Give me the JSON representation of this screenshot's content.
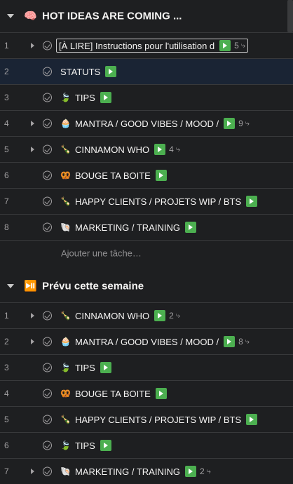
{
  "sections": [
    {
      "emoji": "🧠",
      "title": "HOT IDEAS ARE COMING ...",
      "add_task": "Ajouter une tâche…",
      "tasks": [
        {
          "num": "1",
          "emoji": "",
          "name": "[À LIRE] Instructions pour l'utilisation d",
          "expand": true,
          "subtasks": "5",
          "editing": true
        },
        {
          "num": "2",
          "emoji": "",
          "name": "STATUTS",
          "expand": false,
          "subtasks": "",
          "selected": true
        },
        {
          "num": "3",
          "emoji": "🍃",
          "name": "TIPS",
          "expand": false,
          "subtasks": ""
        },
        {
          "num": "4",
          "emoji": "🧁",
          "name": "MANTRA / GOOD VIBES / MOOD /",
          "expand": true,
          "subtasks": "9"
        },
        {
          "num": "5",
          "emoji": "🍾",
          "name": "CINNAMON WHO",
          "expand": true,
          "subtasks": "4"
        },
        {
          "num": "6",
          "emoji": "🥨",
          "name": "BOUGE TA BOITE",
          "expand": false,
          "subtasks": ""
        },
        {
          "num": "7",
          "emoji": "🍾",
          "name": "HAPPY CLIENTS / PROJETS WIP / BTS",
          "expand": false,
          "subtasks": ""
        },
        {
          "num": "8",
          "emoji": "🐚",
          "name": "MARKETING / TRAINING",
          "expand": false,
          "subtasks": ""
        }
      ]
    },
    {
      "emoji": "⏯️",
      "title": "Prévu cette semaine",
      "add_task": "",
      "tasks": [
        {
          "num": "1",
          "emoji": "🍾",
          "name": "CINNAMON WHO",
          "expand": true,
          "subtasks": "2"
        },
        {
          "num": "2",
          "emoji": "🧁",
          "name": "MANTRA / GOOD VIBES / MOOD /",
          "expand": true,
          "subtasks": "8"
        },
        {
          "num": "3",
          "emoji": "🍃",
          "name": "TIPS",
          "expand": false,
          "subtasks": ""
        },
        {
          "num": "4",
          "emoji": "🥨",
          "name": "BOUGE TA BOITE",
          "expand": false,
          "subtasks": ""
        },
        {
          "num": "5",
          "emoji": "🍾",
          "name": "HAPPY CLIENTS / PROJETS WIP / BTS",
          "expand": false,
          "subtasks": ""
        },
        {
          "num": "6",
          "emoji": "🍃",
          "name": "TIPS",
          "expand": false,
          "subtasks": ""
        },
        {
          "num": "7",
          "emoji": "🐚",
          "name": "MARKETING / TRAINING",
          "expand": true,
          "subtasks": "2"
        }
      ]
    }
  ],
  "subtask_icon": "⤷",
  "colors": {
    "background": "#1e1f21",
    "play": "#4caf50",
    "selected_row": "#1a2434",
    "divider": "#38393b"
  }
}
